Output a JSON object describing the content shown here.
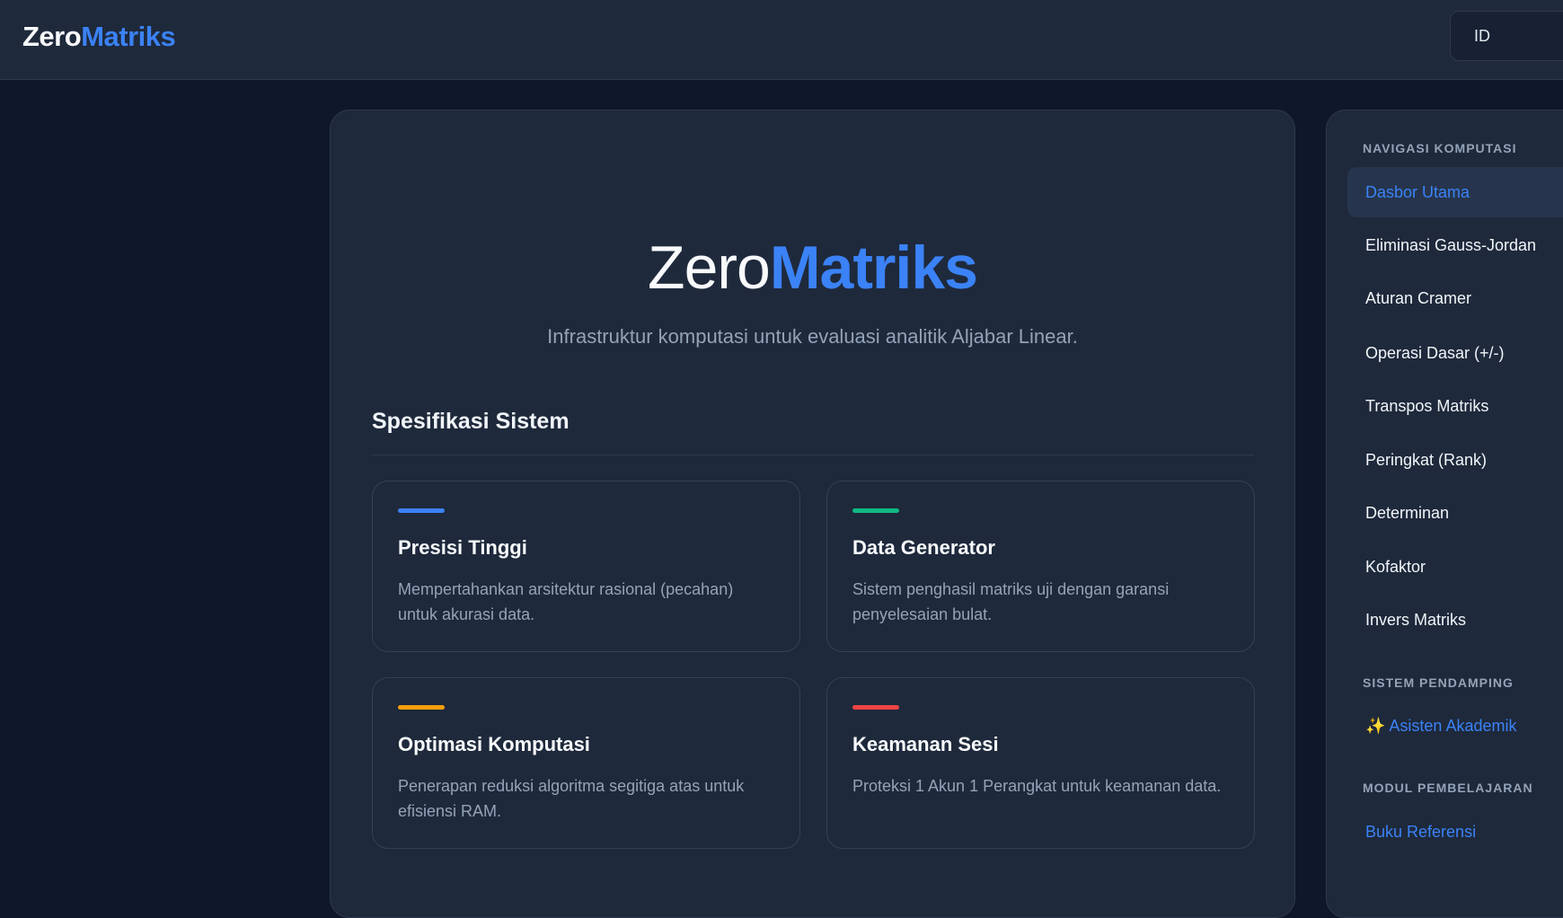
{
  "header": {
    "logo_part1": "Zero",
    "logo_part2": "Matriks",
    "language": "ID"
  },
  "hero": {
    "title_part1": "Zero",
    "title_part2": "Matriks",
    "subtitle": "Infrastruktur komputasi untuk evaluasi analitik Aljabar Linear."
  },
  "specs": {
    "title": "Spesifikasi Sistem",
    "cards": [
      {
        "title": "Presisi Tinggi",
        "desc": "Mempertahankan arsitektur rasional (pecahan) untuk akurasi data.",
        "accent": "#3b82f6"
      },
      {
        "title": "Data Generator",
        "desc": "Sistem penghasil matriks uji dengan garansi penyelesaian bulat.",
        "accent": "#10b981"
      },
      {
        "title": "Optimasi Komputasi",
        "desc": "Penerapan reduksi algoritma segitiga atas untuk efisiensi RAM.",
        "accent": "#f59e0b"
      },
      {
        "title": "Keamanan Sesi",
        "desc": "Proteksi 1 Akun 1 Perangkat untuk keamanan data.",
        "accent": "#ef4444"
      }
    ]
  },
  "sidebar": {
    "group1": "NAVIGASI KOMPUTASI",
    "items": [
      {
        "label": "Dasbor Utama",
        "active": true
      },
      {
        "label": "Eliminasi Gauss-Jordan"
      },
      {
        "label": "Aturan Cramer"
      },
      {
        "label": "Operasi Dasar (+/-)"
      },
      {
        "label": "Transpos Matriks"
      },
      {
        "label": "Peringkat (Rank)"
      },
      {
        "label": "Determinan"
      },
      {
        "label": "Kofaktor"
      },
      {
        "label": "Invers Matriks"
      }
    ],
    "group2": "SISTEM PENDAMPING",
    "assistant": "✨ Asisten Akademik",
    "group3": "MODUL PEMBELAJARAN",
    "reference": "Buku Referensi"
  },
  "colors": {
    "accent": "#3b82f6",
    "background": "#0f172a",
    "surface": "#1e293b"
  }
}
